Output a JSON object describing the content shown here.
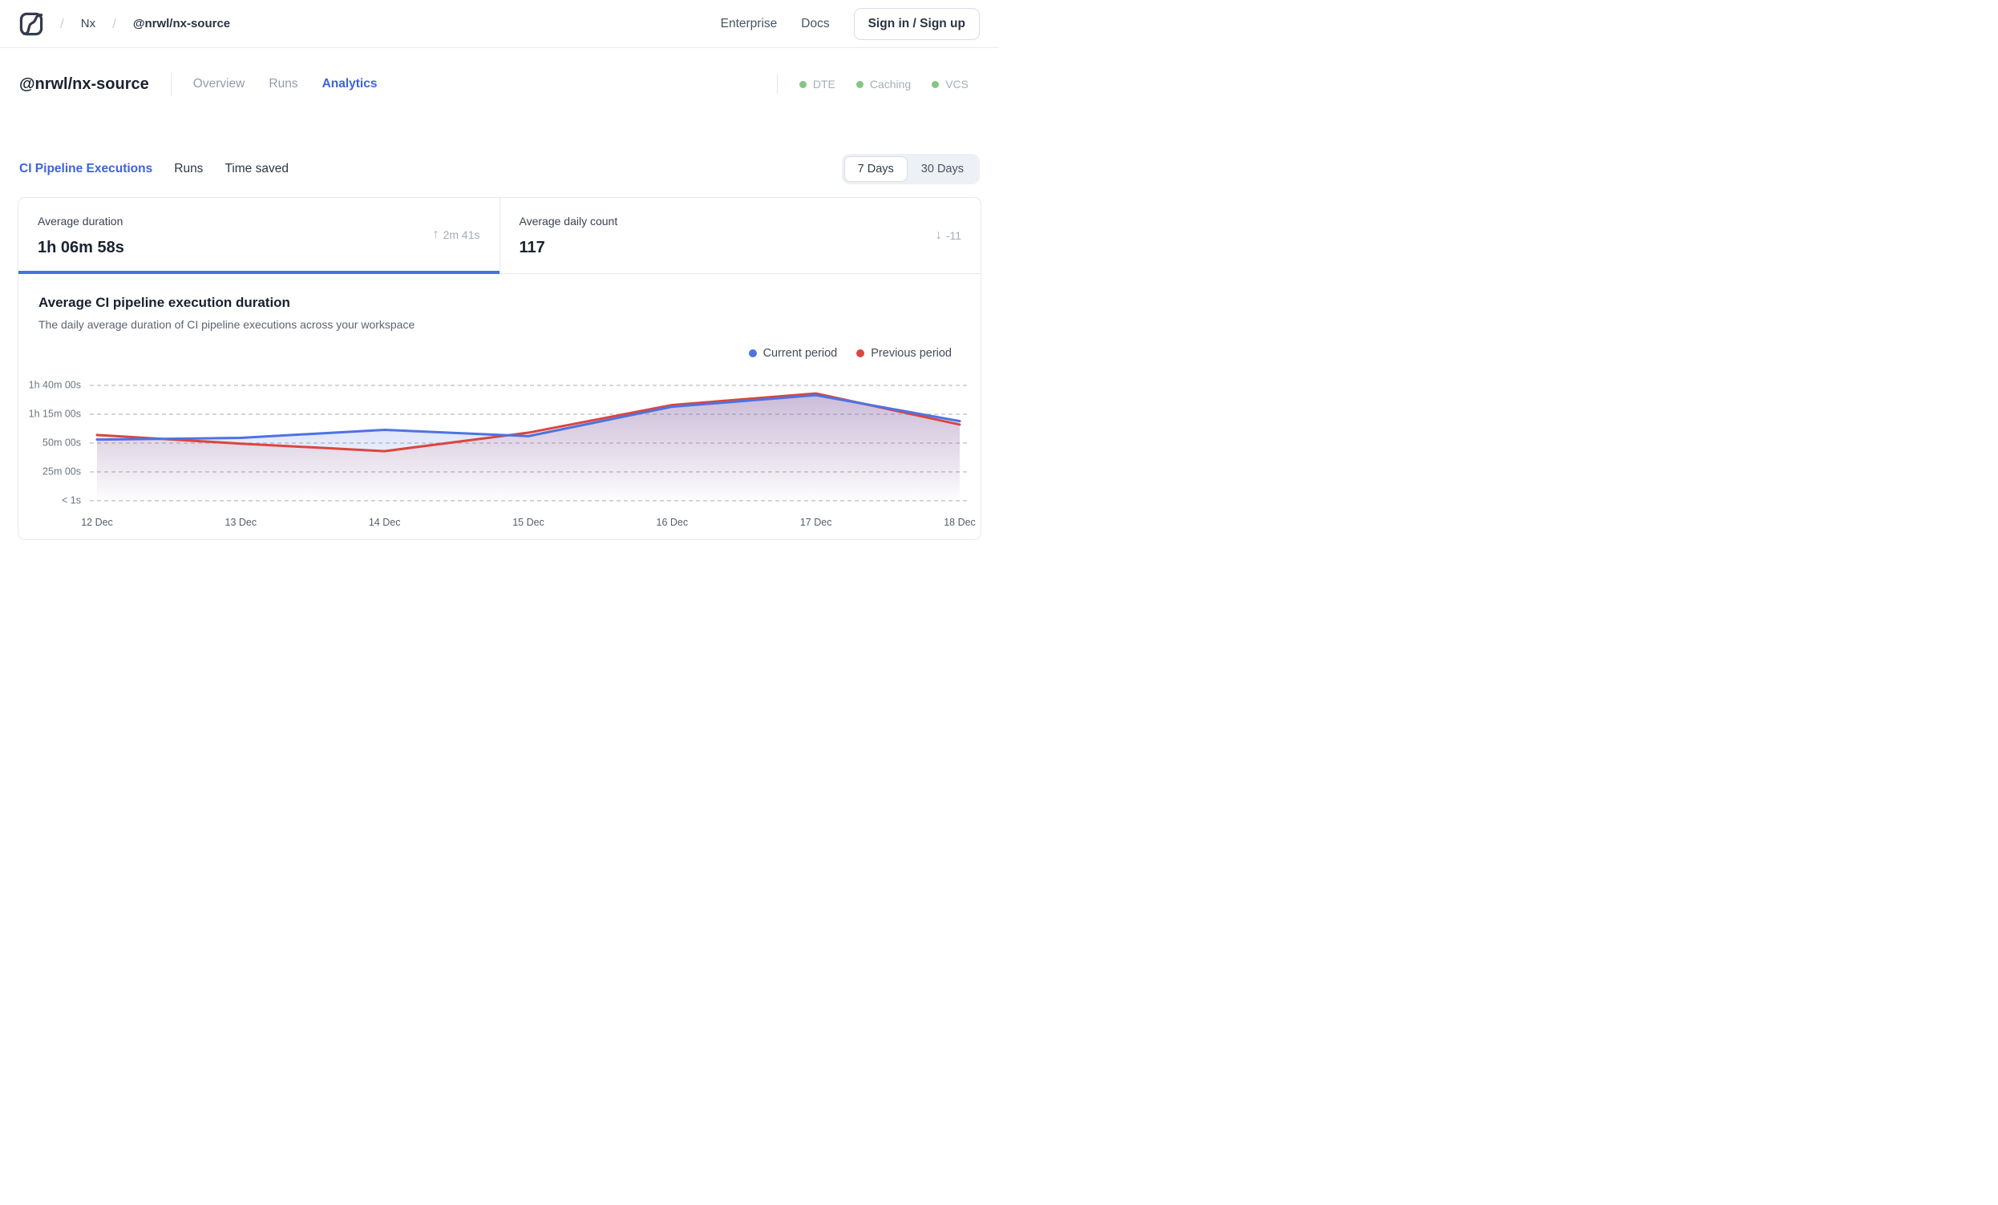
{
  "navbar": {
    "breadcrumb": {
      "separator": "/",
      "org": "Nx",
      "workspace": "@nrwl/nx-source"
    },
    "links": {
      "enterprise": "Enterprise",
      "docs": "Docs"
    },
    "signin_label": "Sign in / Sign up"
  },
  "workspace_header": {
    "title": "@nrwl/nx-source",
    "tabs": [
      {
        "label": "Overview",
        "active": false
      },
      {
        "label": "Runs",
        "active": false
      },
      {
        "label": "Analytics",
        "active": true
      }
    ],
    "statuses": [
      {
        "label": "DTE"
      },
      {
        "label": "Caching"
      },
      {
        "label": "VCS"
      }
    ],
    "status_color": "#82c785"
  },
  "analytics": {
    "tabs": [
      {
        "label": "CI Pipeline Executions",
        "active": true
      },
      {
        "label": "Runs",
        "active": false
      },
      {
        "label": "Time saved",
        "active": false
      }
    ],
    "period_toggle": {
      "options": [
        "7 Days",
        "30 Days"
      ],
      "selected": "7 Days"
    }
  },
  "stat_cards": [
    {
      "title": "Average duration",
      "value": "1h 06m 58s",
      "delta": "2m 41s",
      "delta_direction": "up",
      "active": true
    },
    {
      "title": "Average daily count",
      "value": "117",
      "delta": "-11",
      "delta_direction": "down",
      "active": false
    }
  ],
  "chart": {
    "title": "Average CI pipeline execution duration",
    "subtitle": "The daily average duration of CI pipeline executions across your workspace"
  },
  "chart_data": {
    "type": "line",
    "title": "Average CI pipeline execution duration",
    "x": [
      "12 Dec",
      "13 Dec",
      "14 Dec",
      "15 Dec",
      "16 Dec",
      "17 Dec",
      "18 Dec"
    ],
    "y_ticks": [
      {
        "label": "1h 40m 00s",
        "minutes": 100
      },
      {
        "label": "1h 15m 00s",
        "minutes": 75
      },
      {
        "label": "50m 00s",
        "minutes": 50
      },
      {
        "label": "25m 00s",
        "minutes": 25
      },
      {
        "label": "< 1s",
        "minutes": 0
      }
    ],
    "ylim_minutes": [
      0,
      100
    ],
    "grid": "dashed-horizontal",
    "legend_position": "top-right",
    "series": [
      {
        "name": "Current period",
        "color": "#4e73e1",
        "values_minutes": [
          53,
          54.5,
          61.5,
          56,
          81.5,
          91.5,
          69
        ]
      },
      {
        "name": "Previous period",
        "color": "#dc4540",
        "values_minutes": [
          57,
          49.5,
          43,
          59,
          83,
          93,
          66
        ]
      }
    ]
  },
  "accent_color": "#3d63dc"
}
